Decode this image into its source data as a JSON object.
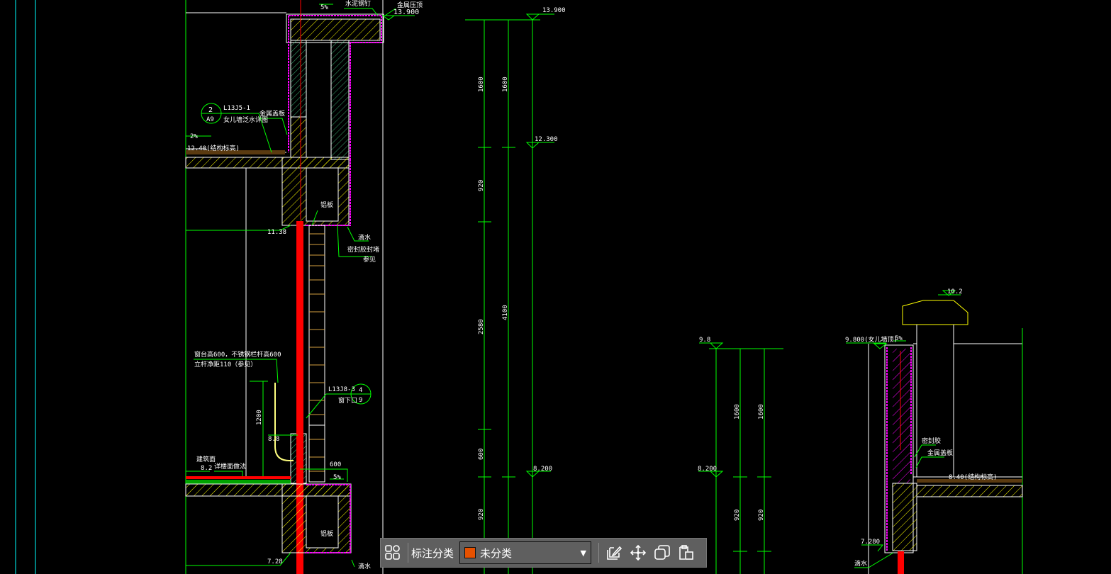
{
  "colors": {
    "background": "#000000",
    "dimension": "#00ff00",
    "outline": "#ffffff",
    "insulation": "#ff00ff",
    "axis": "#ff0000",
    "concrete": "#ffff00",
    "grid": "#00ffff",
    "category_swatch": "#e65100"
  },
  "left_detail": {
    "slope_top": "5%",
    "nail_label": "水泥钢钉",
    "cap_label": "金属压顶",
    "elev_top": "13.900",
    "ref_code": "L13J5-1",
    "ref_num": "2",
    "ref_page": "A9",
    "ref_desc": "女儿墙泛水详图",
    "cover_label": "金属盖板",
    "slope_roof": "2%",
    "struct_elev": "12.40(结构标高)",
    "panel_label": "铝板",
    "drip_label": "滴水",
    "seal_label": "密封胶封堵",
    "see_label": "参见",
    "elev_1138": "11.38",
    "rail_note_1": "窗台高600，不锈钢栏杆高600",
    "rail_note_2": "立杆净距110（参见）",
    "dim_1200": "1200",
    "elev_88": "8.8",
    "ref2_code": "L13J8-3",
    "ref2_num": "4",
    "ref2_page": "9",
    "ref2_desc": "窗下口",
    "dim_600": "600",
    "slope_sill": "5%",
    "elev_82": "8.2",
    "floor_note": "详楼面做法",
    "floor_label": "建筑面",
    "panel_label_2": "铝板",
    "elev_728": "7.28",
    "drip_label_2": "滴水"
  },
  "mid_dims": {
    "elev_13900": "13.900",
    "elev_12300": "12.300",
    "elev_8200": "8.200",
    "d1": "1600",
    "d2": "1600",
    "d3": "920",
    "d4": "2580",
    "d5": "4100",
    "d6": "600",
    "d7": "920"
  },
  "right_dims": {
    "elev_98": "9.8",
    "elev_8200": "8.200",
    "d1": "1600",
    "d2": "1600",
    "d3": "920"
  },
  "right_detail": {
    "elev_102": "10.2",
    "elev_9800": "9.800(女儿墙顶)",
    "slope": "5%",
    "seal_label": "密封胶",
    "cover_label": "金属盖板",
    "struct_elev": "8.40(结构标高)",
    "elev_7280": "7.280",
    "drip_label": "滴水"
  },
  "toolbar": {
    "category_label": "标注分类",
    "category_value": "未分类",
    "icons": [
      "layout-grid-icon",
      "edit-icon",
      "move-icon",
      "copy-icon",
      "paste-icon"
    ]
  }
}
